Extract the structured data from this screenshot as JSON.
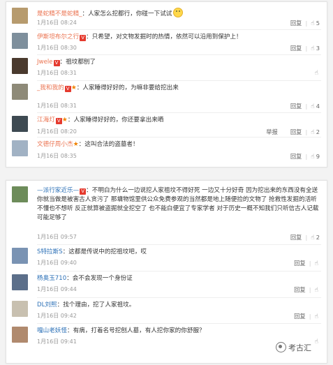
{
  "panel1": {
    "comments": [
      {
        "user": "是蛇精不是蛇精_",
        "vip": "",
        "star": false,
        "text": "：人家怎么挖都行，你碰一下试试",
        "emoji": true,
        "time": "1月16日 08:24",
        "report": "",
        "reply": "回复",
        "likes": "5",
        "avatar_color": "#b79b6e"
      },
      {
        "user": "伊斯坦布尔之行",
        "vip": "V",
        "star": false,
        "text": "：只希望，对文物发掘时的热情，依然可以沿用到保护上！",
        "emoji": false,
        "time": "1月16日 08:30",
        "report": "",
        "reply": "回复",
        "likes": "3",
        "avatar_color": "#7e8f9c"
      },
      {
        "user": "Jwele",
        "vip": "V",
        "star": false,
        "text": "：祖坟都刨了",
        "emoji": false,
        "time": "1月16日 08:31",
        "report": "",
        "reply": "",
        "likes": "",
        "avatar_color": "#4a3a2e"
      },
      {
        "user": "_我和我的",
        "vip": "V",
        "star": true,
        "text": "：人家睡得好好的，为嘛非要给挖出来",
        "emoji": false,
        "time": "1月16日 08:31",
        "report": "",
        "reply": "回复",
        "likes": "4",
        "avatar_color": "#8e8a78"
      },
      {
        "user": "江海灯",
        "vip": "V",
        "star": true,
        "text": "：人家睡得好好的，你还要拿出来晒",
        "emoji": false,
        "time": "1月16日 08:20",
        "report": "举报",
        "reply": "回复",
        "likes": "2",
        "avatar_color": "#3e4a52"
      },
      {
        "user": "文德仔周小杰",
        "vip": "",
        "star": true,
        "text": "：这叫合法的盗墓者！",
        "emoji": false,
        "time": "1月16日 08:35",
        "report": "",
        "reply": "回复",
        "likes": "9",
        "avatar_color": "#a1b2c4"
      }
    ]
  },
  "panel2": {
    "comments": [
      {
        "user": "—派行家近乐—",
        "vip": "V",
        "star": false,
        "text": "：不明白为什么一边说挖人家祖坟不得好死  一边又十分好奇  因为挖出来的东西没有全送你就当做是被害古人贪污了  那墉物馆里供公众免费参观的当然都是地上随便捡的文物了  抢救性发掘的活听不懂也不想听  反正就算被盗掘就全挖空了  也不能白便宜了专家学者  对于历史一概不知我们只听信古人记载可能足够了",
        "emoji": false,
        "time": "1月16日 09:57",
        "report": "",
        "reply": "回复",
        "likes": "2",
        "avatar_color": "#6d8c5a"
      },
      {
        "user": "S特拉斯S",
        "vip": "",
        "star": false,
        "text": "：这都是传说中的挖祖坟吧，哎",
        "emoji": false,
        "time": "1月16日 09:40",
        "report": "",
        "reply": "回复",
        "likes": "",
        "avatar_color": "#7a93b3"
      },
      {
        "user": "杨奥玉710",
        "vip": "",
        "star": false,
        "text": "：会不会发现一个身份证",
        "emoji": false,
        "time": "1月16日 09:44",
        "report": "",
        "reply": "回复",
        "likes": "",
        "avatar_color": "#5c6f8a"
      },
      {
        "user": "DL刘熙",
        "vip": "",
        "star": false,
        "text": "：找个理由，挖了人家祖坟。",
        "emoji": false,
        "time": "1月16日 09:42",
        "report": "",
        "reply": "回复",
        "likes": "",
        "avatar_color": "#c8c0b0"
      },
      {
        "user": "嘎山老妖怪",
        "vip": "",
        "star": false,
        "text": "：有病，打着名号挖刨人墓，有人挖你家的你舒服？",
        "emoji": false,
        "time": "1月16日 09:41",
        "report": "",
        "reply": "",
        "likes": "",
        "avatar_color": "#b08a6e"
      }
    ]
  },
  "watermark": "考古汇"
}
